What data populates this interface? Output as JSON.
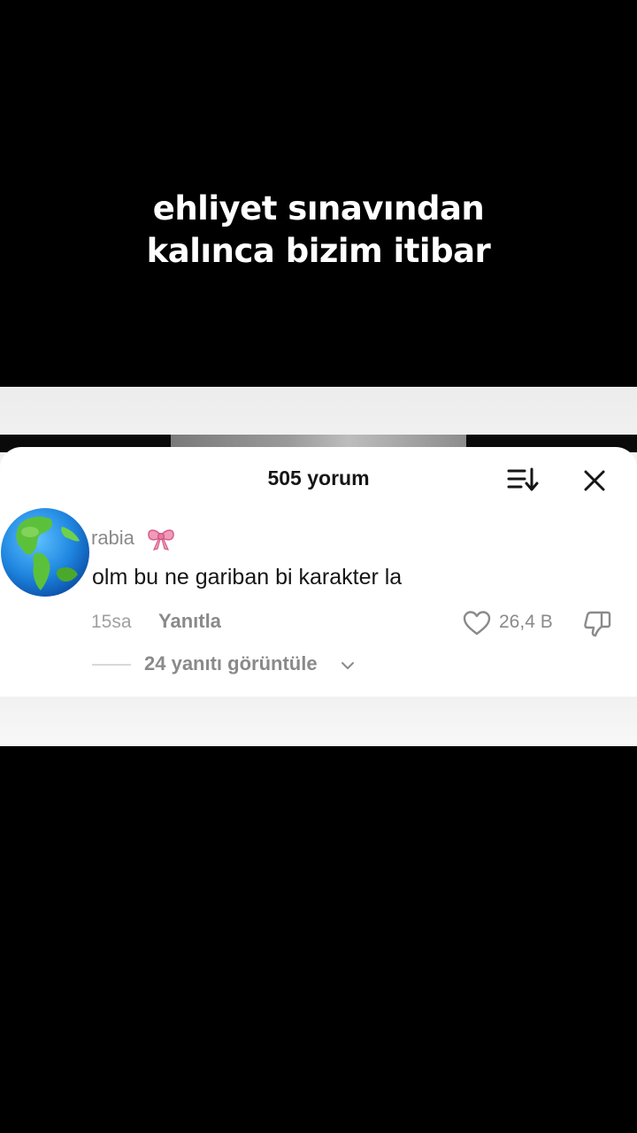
{
  "caption": {
    "line1": "ehliyet sınavından",
    "line2": "kalınca bizim itibar"
  },
  "comments_sheet": {
    "title": "505 yorum",
    "sort_icon": "sort-icon",
    "close_icon": "close-icon",
    "comment": {
      "avatar_icon": "globe-avatar",
      "username": "rabia",
      "username_emoji_icon": "ribbon-bow-icon",
      "text": "olm bu ne gariban bi karakter la",
      "time": "15sa",
      "reply_label": "Yanıtla",
      "like_icon": "heart-icon",
      "like_count": "26,4 B",
      "dislike_icon": "thumbs-down-icon",
      "view_replies_label": "24 yanıtı görüntüle",
      "expand_icon": "chevron-down-icon"
    }
  },
  "colors": {
    "background": "#000000",
    "sheet": "#ffffff",
    "primary_text": "#161616",
    "secondary_text": "#8a8a8a",
    "bow_pink": "#f29ab8"
  }
}
